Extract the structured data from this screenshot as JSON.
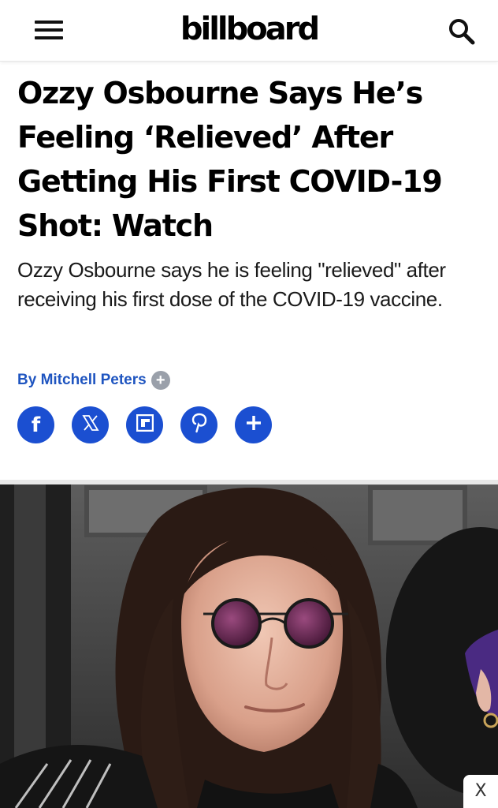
{
  "header": {
    "logo_text": "billboard",
    "menu_icon": "hamburger-menu-icon",
    "search_icon": "search-icon"
  },
  "article": {
    "headline": "Ozzy Osbourne Says He’s Feeling ‘Relieved’ After Getting His First COVID-19 Shot: Watch",
    "dek": "Ozzy Osbourne says he is feeling \"relieved\" after receiving his first dose of the COVID-19 vaccine.",
    "byline": "By Mitchell Peters",
    "byline_plus": "+"
  },
  "share": {
    "buttons": [
      {
        "icon": "facebook-icon",
        "glyph": "f"
      },
      {
        "icon": "x-icon",
        "glyph": "X"
      },
      {
        "icon": "flipboard-icon",
        "glyph": ""
      },
      {
        "icon": "pinterest-icon",
        "glyph": "P"
      },
      {
        "icon": "plus-icon",
        "glyph": "+"
      }
    ]
  },
  "ad": {
    "close_label": "X"
  },
  "colors": {
    "accent_blue": "#1b4fd1",
    "byline_blue": "#1f55c0"
  }
}
